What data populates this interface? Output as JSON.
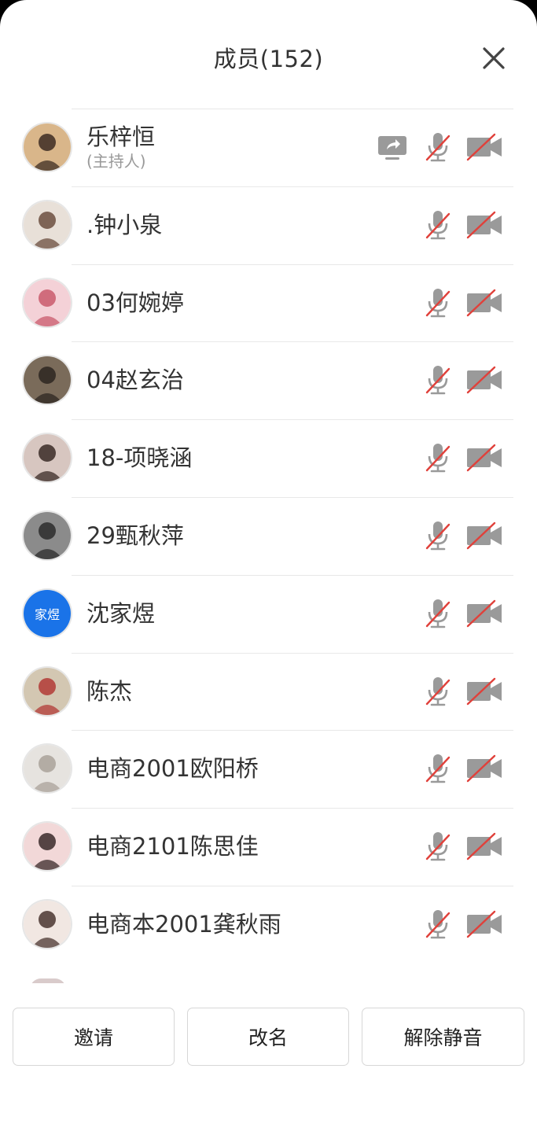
{
  "header": {
    "title": "成员(152)"
  },
  "icons": {
    "close": "close-icon",
    "share": "screen-share-icon",
    "mic": "mic-muted-icon",
    "cam": "camera-off-icon"
  },
  "colors": {
    "muted_slash": "#e0413b",
    "icon_gray": "#9a9a9a",
    "avatar_blue": "#1a73e8"
  },
  "members": [
    {
      "name": "乐梓恒",
      "role": "(主持人)",
      "sharing": true,
      "avatar": "photo"
    },
    {
      "name": ".钟小泉",
      "role": "",
      "sharing": false,
      "avatar": "photo"
    },
    {
      "name": "03何婉婷",
      "role": "",
      "sharing": false,
      "avatar": "photo"
    },
    {
      "name": "04赵玄治",
      "role": "",
      "sharing": false,
      "avatar": "photo"
    },
    {
      "name": "18-项晓涵",
      "role": "",
      "sharing": false,
      "avatar": "photo"
    },
    {
      "name": "29甄秋萍",
      "role": "",
      "sharing": false,
      "avatar": "photo"
    },
    {
      "name": "沈家煜",
      "role": "",
      "sharing": false,
      "avatar": "text",
      "avatar_text": "家煜"
    },
    {
      "name": "陈杰",
      "role": "",
      "sharing": false,
      "avatar": "photo"
    },
    {
      "name": "电商2001欧阳桥",
      "role": "",
      "sharing": false,
      "avatar": "photo"
    },
    {
      "name": "电商2101陈思佳",
      "role": "",
      "sharing": false,
      "avatar": "photo"
    },
    {
      "name": "电商本2001龚秋雨",
      "role": "",
      "sharing": false,
      "avatar": "photo"
    }
  ],
  "footer": {
    "invite": "邀请",
    "rename": "改名",
    "unmute_all": "解除静音"
  }
}
